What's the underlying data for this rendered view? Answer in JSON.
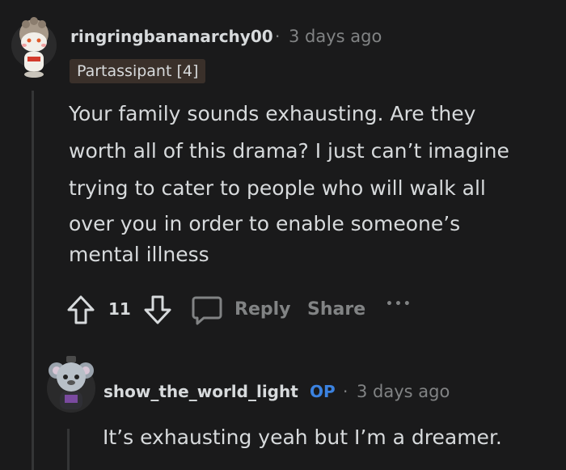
{
  "comment1": {
    "username": "ringringbananarchy00",
    "separator": "·",
    "time": "3 days ago",
    "flair": "Partassipant [4]",
    "body_lines": [
      "Your family sounds exhausting. Are they",
      "worth all of this drama? I just can’t imagine",
      "trying to cater to people who will walk all",
      "over you in order to enable someone’s",
      "mental illness"
    ],
    "votes": "11",
    "reply_label": "Reply",
    "share_label": "Share",
    "more_label": "•••"
  },
  "comment2": {
    "username": "show_the_world_light",
    "op_badge": "OP",
    "separator": "·",
    "time": "3 days ago",
    "body": "It’s exhausting yeah but I’m a dreamer."
  },
  "colors": {
    "background": "#1a1a1b",
    "text": "#d7dadc",
    "muted": "#818384",
    "op_blue": "#3b82e0",
    "flair_bg": "#3a302a"
  }
}
